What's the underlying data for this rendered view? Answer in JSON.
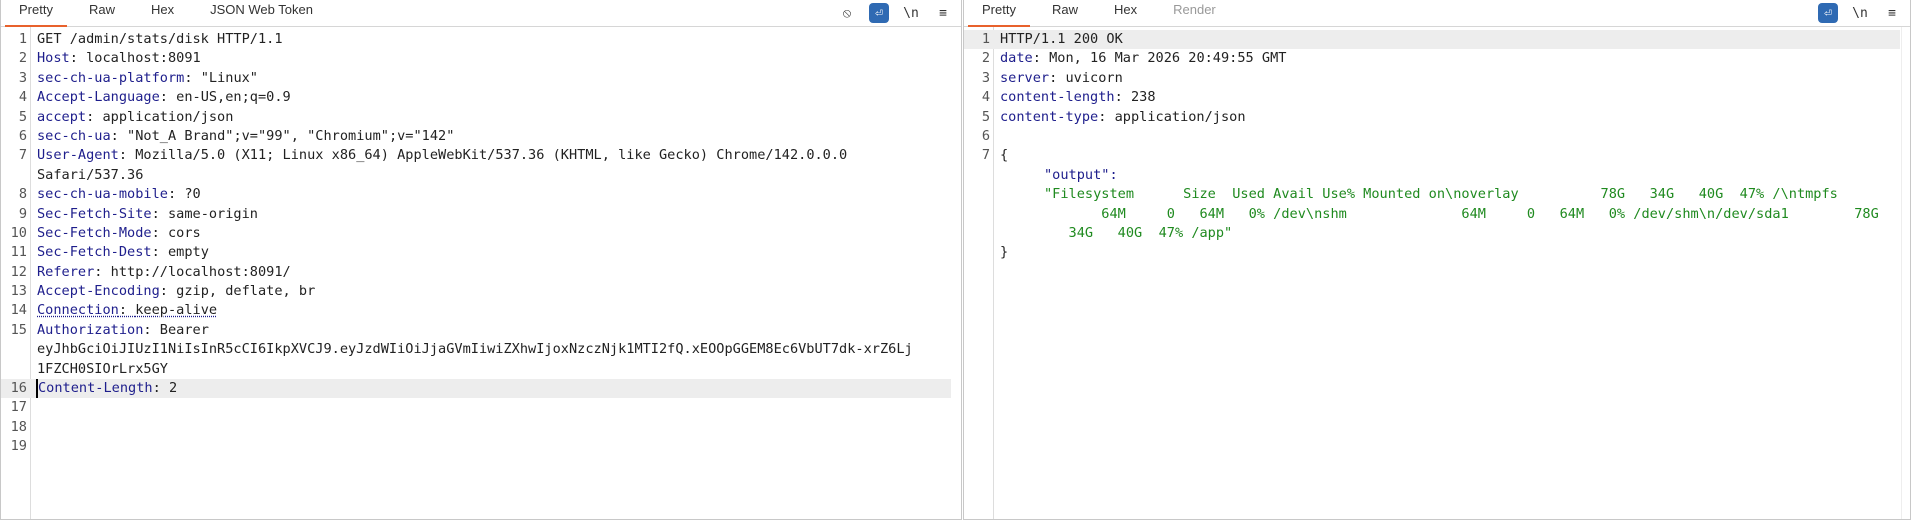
{
  "request": {
    "tabs": [
      "Pretty",
      "Raw",
      "Hex",
      "JSON Web Token"
    ],
    "active_tab": "Pretty",
    "tools": {
      "hide": "⦸",
      "wrap": "⏎",
      "newline": "\\n",
      "menu": "≡"
    },
    "rows": [
      {
        "n": "1",
        "name": "",
        "value": "GET /admin/stats/disk HTTP/1.1"
      },
      {
        "n": "2",
        "name": "Host",
        "value": "localhost:8091"
      },
      {
        "n": "3",
        "name": "sec-ch-ua-platform",
        "value": "\"Linux\""
      },
      {
        "n": "4",
        "name": "Accept-Language",
        "value": "en-US,en;q=0.9"
      },
      {
        "n": "5",
        "name": "accept",
        "value": "application/json"
      },
      {
        "n": "6",
        "name": "sec-ch-ua",
        "value": "\"Not_A Brand\";v=\"99\", \"Chromium\";v=\"142\""
      },
      {
        "n": "7",
        "name": "User-Agent",
        "value": "Mozilla/5.0 (X11; Linux x86_64) AppleWebKit/537.36 (KHTML, like Gecko) Chrome/142.0.0.0"
      },
      {
        "n": "",
        "name": "",
        "value": "Safari/537.36"
      },
      {
        "n": "8",
        "name": "sec-ch-ua-mobile",
        "value": "?0"
      },
      {
        "n": "9",
        "name": "Sec-Fetch-Site",
        "value": "same-origin"
      },
      {
        "n": "10",
        "name": "Sec-Fetch-Mode",
        "value": "cors"
      },
      {
        "n": "11",
        "name": "Sec-Fetch-Dest",
        "value": "empty"
      },
      {
        "n": "12",
        "name": "Referer",
        "value": "http://localhost:8091/"
      },
      {
        "n": "13",
        "name": "Accept-Encoding",
        "value": "gzip, deflate, br"
      },
      {
        "n": "14",
        "name": "Connection",
        "value": "keep-alive"
      },
      {
        "n": "15",
        "name": "Authorization",
        "value": "Bearer"
      },
      {
        "n": "",
        "name": "",
        "value": "eyJhbGciOiJIUzI1NiIsInR5cCI6IkpXVCJ9.eyJzdWIiOiJjaGVmIiwiZXhwIjoxNzczNjk1MTI2fQ.xEOOpGGEM8Ec6VbUT7dk-xrZ6Lj"
      },
      {
        "n": "",
        "name": "",
        "value": "1FZCH0SIOrLrx5GY"
      },
      {
        "n": "16",
        "name": "Content-Length",
        "value": "2"
      },
      {
        "n": "17",
        "name": "",
        "value": ""
      },
      {
        "n": "18",
        "name": "",
        "value": ""
      },
      {
        "n": "19",
        "name": "",
        "value": ""
      }
    ]
  },
  "response": {
    "tabs": [
      "Pretty",
      "Raw",
      "Hex",
      "Render"
    ],
    "active_tab": "Pretty",
    "tools": {
      "wrap": "⏎",
      "newline": "\\n",
      "menu": "≡"
    },
    "rows": [
      {
        "n": "1",
        "name": "",
        "value": "HTTP/1.1 200 OK"
      },
      {
        "n": "2",
        "name": "date",
        "value": "Mon, 16 Mar 2026 20:49:55 GMT"
      },
      {
        "n": "3",
        "name": "server",
        "value": "uvicorn"
      },
      {
        "n": "4",
        "name": "content-length",
        "value": "238"
      },
      {
        "n": "5",
        "name": "content-type",
        "value": "application/json"
      },
      {
        "n": "6",
        "name": "",
        "value": ""
      },
      {
        "n": "7",
        "name": "",
        "value": "{"
      },
      {
        "n": "",
        "name": "",
        "key": "\"output\":"
      },
      {
        "n": "",
        "name": "",
        "str": "\"Filesystem      Size  Used Avail Use% Mounted on\\noverlay          78G   34G   40G  47% /\\ntmpfs"
      },
      {
        "n": "",
        "name": "",
        "str": "       64M     0   64M   0% /dev\\nshm              64M     0   64M   0% /dev/shm\\n/dev/sda1        78G"
      },
      {
        "n": "",
        "name": "",
        "str": "   34G   40G  47% /app\""
      },
      {
        "n": "",
        "name": "",
        "value": "}"
      }
    ]
  }
}
